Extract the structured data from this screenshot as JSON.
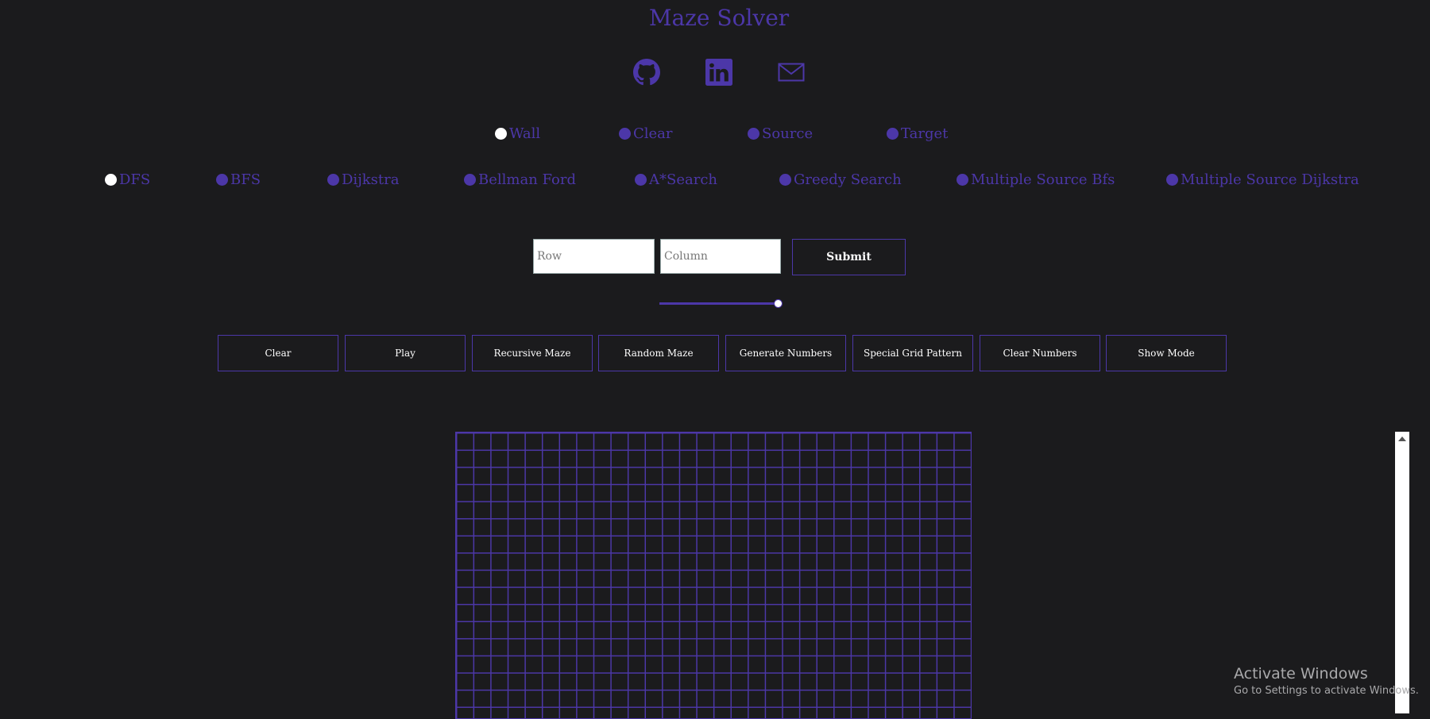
{
  "app": {
    "title": "Maze Solver"
  },
  "social": [
    {
      "name": "github-icon"
    },
    {
      "name": "linkedin-icon"
    },
    {
      "name": "mail-icon"
    }
  ],
  "modes": {
    "selected": "Wall",
    "items": [
      {
        "label": "Wall"
      },
      {
        "label": "Clear"
      },
      {
        "label": "Source"
      },
      {
        "label": "Target"
      }
    ]
  },
  "algorithms": {
    "selected": "DFS",
    "items": [
      {
        "label": "DFS"
      },
      {
        "label": "BFS"
      },
      {
        "label": "Dijkstra"
      },
      {
        "label": "Bellman Ford"
      },
      {
        "label": "A*Search"
      },
      {
        "label": "Greedy Search"
      },
      {
        "label": "Multiple Source Bfs"
      },
      {
        "label": "Multiple Source Dijkstra"
      }
    ]
  },
  "size_form": {
    "row_placeholder": "Row",
    "column_placeholder": "Column",
    "submit_label": "Submit"
  },
  "speed_slider": {
    "value_fraction": 1.0
  },
  "actions": [
    {
      "label": "Clear"
    },
    {
      "label": "Play"
    },
    {
      "label": "Recursive Maze"
    },
    {
      "label": "Random Maze"
    },
    {
      "label": "Generate Numbers"
    },
    {
      "label": "Special Grid Pattern"
    },
    {
      "label": "Clear Numbers"
    },
    {
      "label": "Show Mode"
    }
  ],
  "watermark": {
    "line1": "Activate Windows",
    "line2": "Go to Settings to activate Windows."
  },
  "colors": {
    "accent": "#4c37a8",
    "background": "#1b1b1d",
    "selected_dot": "#ffffff"
  }
}
